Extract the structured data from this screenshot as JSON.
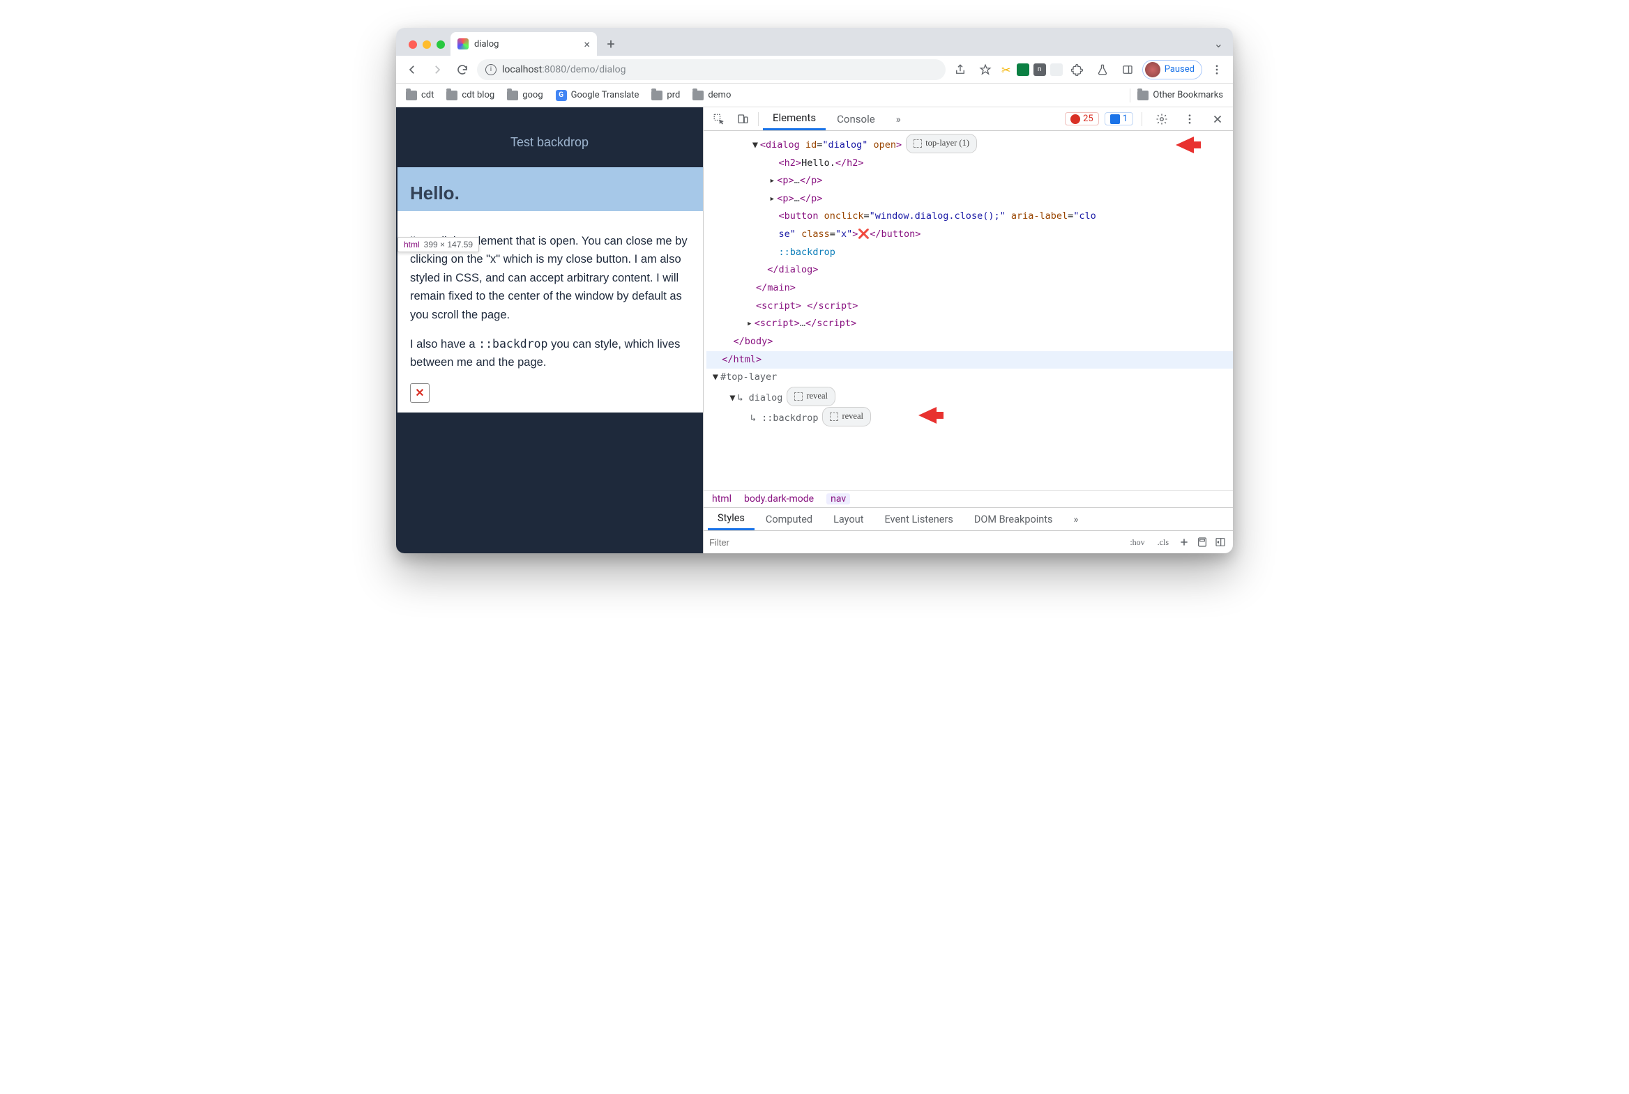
{
  "window": {
    "tab_title": "dialog",
    "url_host": "localhost",
    "url_port": ":8080",
    "url_path": "/demo/dialog",
    "paused_label": "Paused"
  },
  "bookmarks": {
    "items": [
      "cdt",
      "cdt blog",
      "goog",
      "Google Translate",
      "prd",
      "demo"
    ],
    "other": "Other Bookmarks"
  },
  "page": {
    "demo_button": "Test backdrop",
    "heading": "Hello.",
    "tooltip_tag": "html",
    "tooltip_dim": "399 × 147.59",
    "p1": "I'm a dialog element that is open. You can close me by clicking on the \"x\" which is my close button. I am also styled in CSS, and can accept arbitrary content. I will remain fixed to the center of the window by default as you scroll the page.",
    "p2_a": "I also have a ",
    "p2_code": "::backdrop",
    "p2_b": " you can style, which lives between me and the page.",
    "close_glyph": "✕"
  },
  "devtools": {
    "tabs": {
      "elements": "Elements",
      "console": "Console"
    },
    "errors": "25",
    "infos": "1",
    "badge_top_layer": "top-layer (1)",
    "badge_reveal": "reveal",
    "tree": {
      "dialog_open": "<dialog id=\"dialog\" open>",
      "h2": "<h2>Hello.</h2>",
      "p_collapsed": "<p>…</p>",
      "button_line1": "<button onclick=\"window.dialog.close();\" aria-label=\"clo",
      "button_line2": "se\" class=\"x\">",
      "button_x": "❌",
      "button_close": "</button>",
      "backdrop": "::backdrop",
      "dialog_close": "</dialog>",
      "main_close": "</main>",
      "script1": "<script> </script>",
      "script2": "<script>…</script>",
      "body_close": "</body>",
      "html_close": "</html>",
      "top_layer_label": "#top-layer",
      "tl_dialog": "dialog",
      "tl_backdrop": "::backdrop"
    },
    "breadcrumbs": [
      "html",
      "body.dark-mode",
      "nav"
    ],
    "styles_tabs": [
      "Styles",
      "Computed",
      "Layout",
      "Event Listeners",
      "DOM Breakpoints"
    ],
    "filter_placeholder": "Filter",
    "hov": ":hov",
    "cls": ".cls"
  }
}
